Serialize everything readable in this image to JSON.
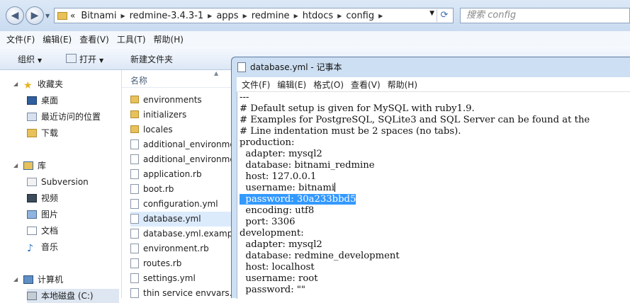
{
  "explorer": {
    "address": {
      "overflow": "«",
      "crumbs": [
        "Bitnami",
        "redmine-3.4.3-1",
        "apps",
        "redmine",
        "htdocs",
        "config"
      ]
    },
    "search_placeholder": "搜索 config",
    "menu": [
      "文件(F)",
      "编辑(E)",
      "查看(V)",
      "工具(T)",
      "帮助(H)"
    ],
    "toolbar": {
      "organize": "组织",
      "open": "打开",
      "new_folder": "新建文件夹"
    },
    "sidebar": {
      "favorites": "收藏夹",
      "desktop": "桌面",
      "recent": "最近访问的位置",
      "downloads": "下载",
      "libraries": "库",
      "subversion": "Subversion",
      "videos": "视频",
      "pictures": "图片",
      "documents": "文档",
      "music": "音乐",
      "computer": "计算机",
      "local_disk": "本地磁盘 (C:)"
    },
    "column_name": "名称",
    "files": [
      {
        "name": "environments",
        "type": "folder"
      },
      {
        "name": "initializers",
        "type": "folder"
      },
      {
        "name": "locales",
        "type": "folder"
      },
      {
        "name": "additional_environment",
        "type": "doc"
      },
      {
        "name": "additional_environment",
        "type": "doc"
      },
      {
        "name": "application.rb",
        "type": "doc"
      },
      {
        "name": "boot.rb",
        "type": "doc"
      },
      {
        "name": "configuration.yml",
        "type": "doc"
      },
      {
        "name": "database.yml",
        "type": "doc",
        "selected": true
      },
      {
        "name": "database.yml.example",
        "type": "doc"
      },
      {
        "name": "environment.rb",
        "type": "doc"
      },
      {
        "name": "routes.rb",
        "type": "doc"
      },
      {
        "name": "settings.yml",
        "type": "doc"
      },
      {
        "name": "thin service envvars.",
        "type": "doc"
      }
    ]
  },
  "notepad": {
    "title": "database.yml - 记事本",
    "menu": [
      "文件(F)",
      "编辑(E)",
      "格式(O)",
      "查看(V)",
      "帮助(H)"
    ],
    "lines": [
      "---",
      "# Default setup is given for MySQL with ruby1.9.",
      "# Examples for PostgreSQL, SQLite3 and SQL Server can be found at the",
      "# Line indentation must be 2 spaces (no tabs).",
      "production:",
      "  adapter: mysql2",
      "  database: bitnami_redmine",
      "  host: 127.0.0.1",
      "  username: bitnami",
      "  password: 30a233bbd5",
      "  encoding: utf8",
      "  port: 3306",
      "development:",
      "  adapter: mysql2",
      "  database: redmine_development",
      "  host: localhost",
      "  username: root",
      "  password: \"\""
    ],
    "selection_color": "#3399ff"
  }
}
